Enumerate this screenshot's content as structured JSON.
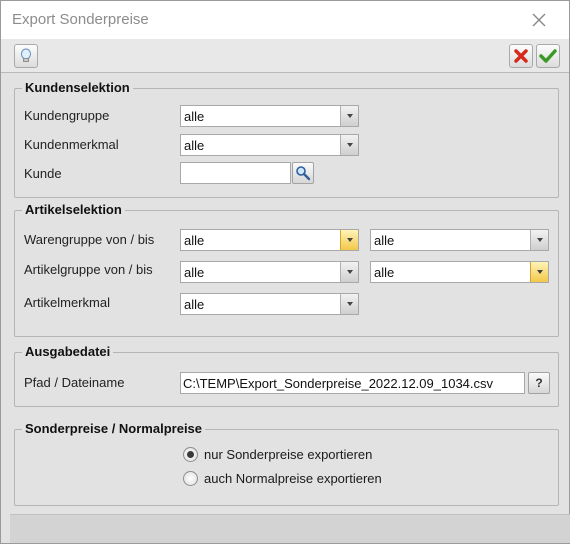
{
  "window": {
    "title": "Export Sonderpreise"
  },
  "toolbar": {
    "hint_icon": "lightbulb-icon",
    "cancel_icon": "red-x-icon",
    "ok_icon": "green-check-icon"
  },
  "kundenselektion": {
    "legend": "Kundenselektion",
    "kundengruppe": {
      "label": "Kundengruppe",
      "value": "alle"
    },
    "kundenmerkmal": {
      "label": "Kundenmerkmal",
      "value": "alle"
    },
    "kunde": {
      "label": "Kunde",
      "value": ""
    }
  },
  "artikelselektion": {
    "legend": "Artikelselektion",
    "warengruppe": {
      "label": "Warengruppe von / bis",
      "from": "alle",
      "to": "alle"
    },
    "artikelgruppe": {
      "label": "Artikelgruppe von / bis",
      "from": "alle",
      "to": "alle"
    },
    "artikelmerkmal": {
      "label": "Artikelmerkmal",
      "value": "alle"
    }
  },
  "ausgabedatei": {
    "legend": "Ausgabedatei",
    "pfad": {
      "label": "Pfad / Dateiname",
      "value": "C:\\TEMP\\Export_Sonderpreise_2022.12.09_1034.csv"
    },
    "browse_label": "?"
  },
  "preise": {
    "legend": "Sonderpreise / Normalpreise",
    "options": [
      {
        "label": "nur Sonderpreise exportieren",
        "selected": true
      },
      {
        "label": "auch Normalpreise exportieren",
        "selected": false
      }
    ]
  }
}
